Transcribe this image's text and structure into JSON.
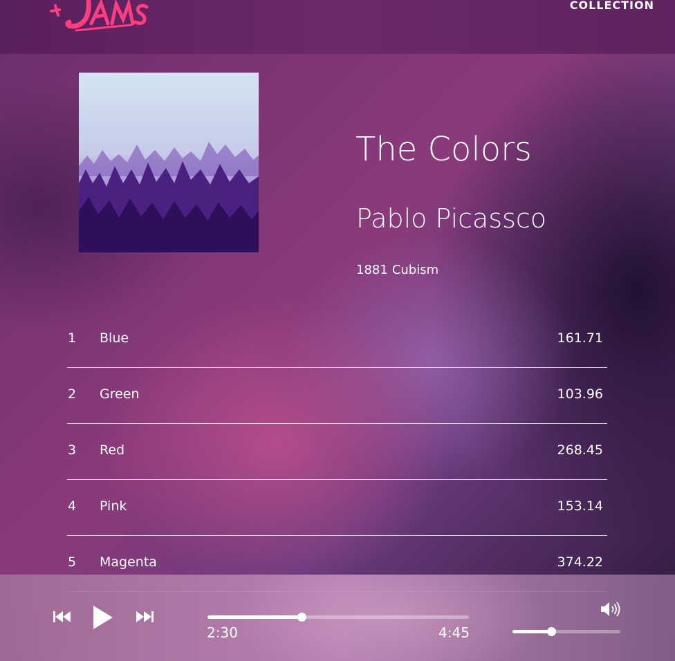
{
  "header": {
    "logo_text": "Jams",
    "nav_collection_label": "COLLECTION"
  },
  "album": {
    "title": "The Colors",
    "artist": "Pablo Picassco",
    "year": "1881",
    "label": "Cubism",
    "art_description_icon": "album-art-image"
  },
  "songs": [
    {
      "number": "1",
      "name": "Blue",
      "duration": "161.71"
    },
    {
      "number": "2",
      "name": "Green",
      "duration": "103.96"
    },
    {
      "number": "3",
      "name": "Red",
      "duration": "268.45"
    },
    {
      "number": "4",
      "name": "Pink",
      "duration": "153.14"
    },
    {
      "number": "5",
      "name": "Magenta",
      "duration": "374.22"
    }
  ],
  "player": {
    "current_time": "2:30",
    "total_time": "4:45",
    "progress_fraction": 0.36,
    "volume_fraction": 0.36,
    "icons": {
      "previous": "skip-previous-icon",
      "play": "play-icon",
      "next": "skip-next-icon",
      "volume": "volume-icon"
    }
  },
  "colors": {
    "header_bg": "#5e2360",
    "accent_logo": "#ff3d7f",
    "text": "#ffffff"
  }
}
